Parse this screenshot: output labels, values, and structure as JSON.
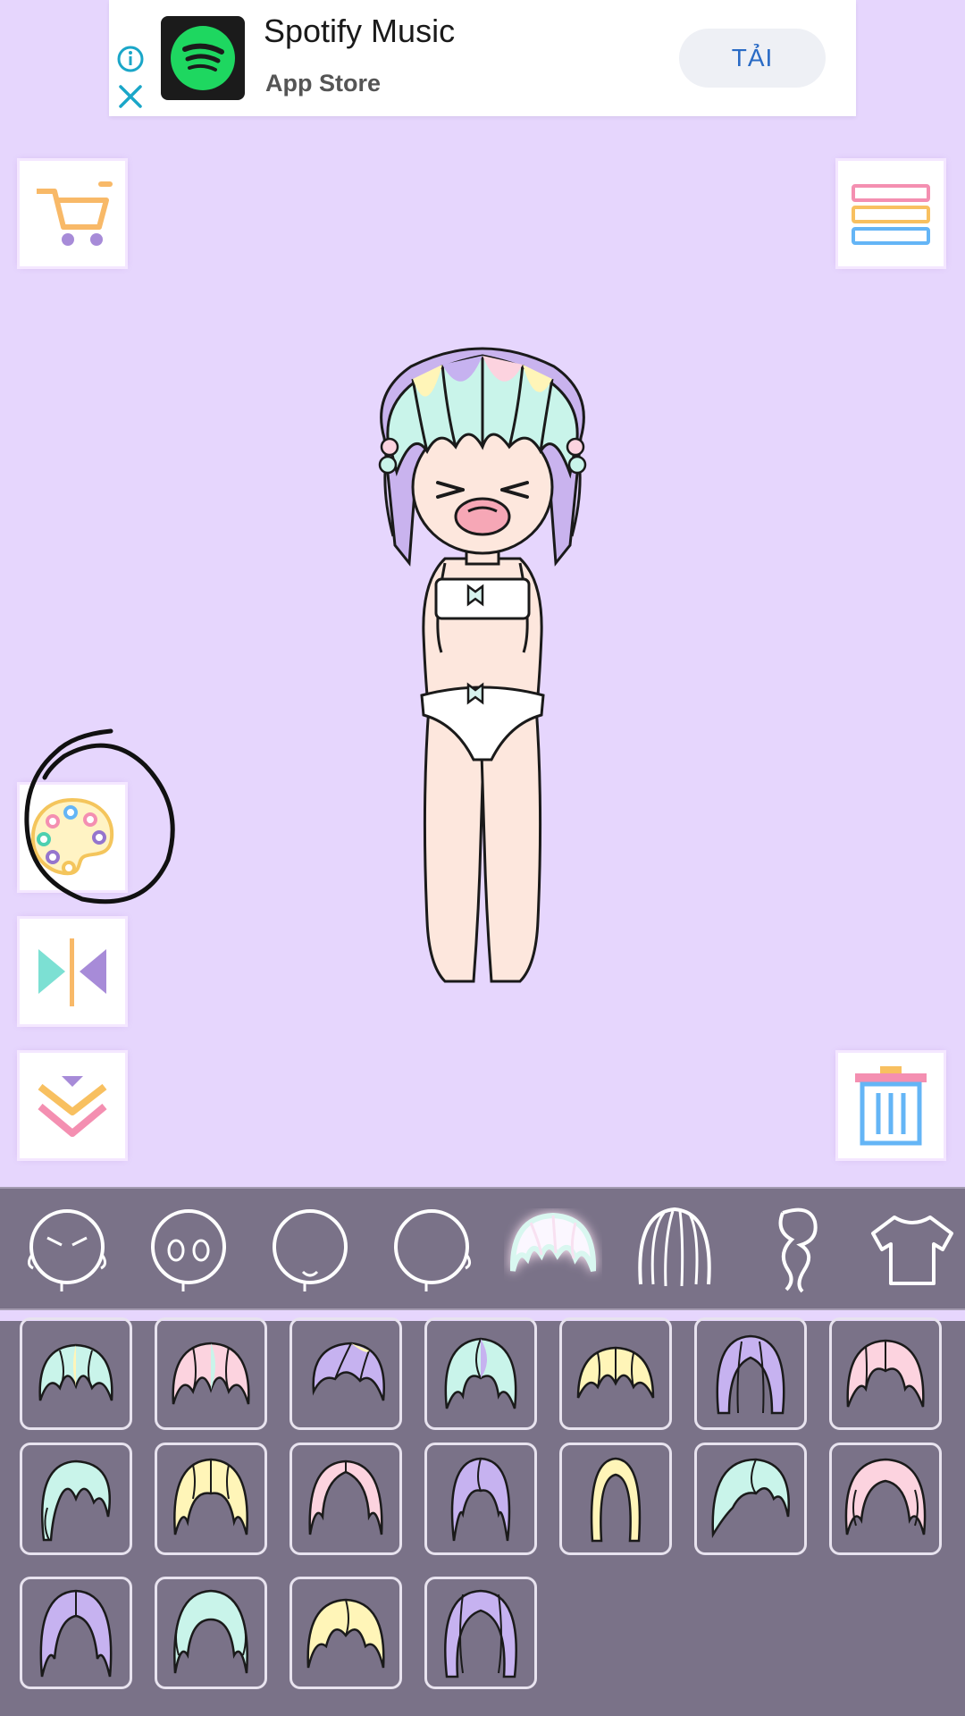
{
  "ad": {
    "title": "Spotify Music",
    "subtitle": "App Store",
    "cta_label": "TẢI",
    "icons": [
      "info-icon",
      "close-icon",
      "spotify-logo"
    ]
  },
  "side_buttons": {
    "left": [
      "cart-icon",
      "palette-icon",
      "flip-icon",
      "collapse-icon"
    ],
    "right": [
      "menu-icon",
      "trash-icon"
    ]
  },
  "categories": [
    {
      "name": "eyes-closed-face",
      "selected": false
    },
    {
      "name": "eyes-face",
      "selected": false
    },
    {
      "name": "mouth-face",
      "selected": false
    },
    {
      "name": "blank-face",
      "selected": false
    },
    {
      "name": "bangs-hair",
      "selected": true
    },
    {
      "name": "back-hair",
      "selected": false
    },
    {
      "name": "ponytail-hair",
      "selected": false
    },
    {
      "name": "shirt",
      "selected": false
    }
  ],
  "items": {
    "rows": [
      [
        "hair-1",
        "hair-2",
        "hair-3",
        "hair-4",
        "hair-5",
        "hair-6",
        "hair-7"
      ],
      [
        "hair-8",
        "hair-9",
        "hair-10",
        "hair-11",
        "hair-12",
        "hair-13",
        "hair-14"
      ],
      [
        "hair-15",
        "hair-16",
        "hair-17",
        "hair-18"
      ]
    ]
  },
  "colors": {
    "background": "#e6d6fd",
    "panel": "#7a7288",
    "accent_pink": "#f48fb1",
    "accent_yellow": "#ffd54f",
    "accent_blue": "#64b5f6",
    "accent_mint": "#86ecd8",
    "accent_lilac": "#b39ddb"
  }
}
